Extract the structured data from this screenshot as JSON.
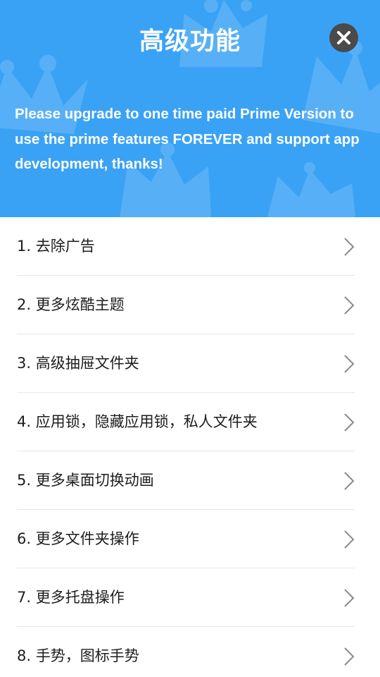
{
  "colors": {
    "header_bg": "#3aa2f5",
    "crown_shape": "#62b6f7",
    "close_button_bg": "#4a4a4a",
    "text_primary": "#1d1d1d",
    "divider": "#e6e6e6",
    "chevron": "#8a8a8a"
  },
  "header": {
    "title": "高级功能",
    "close_icon": "close-icon",
    "background_icon": "crown-icon",
    "message": "Please upgrade to one time paid Prime Version to use the prime features FOREVER and support app development, thanks!"
  },
  "features": [
    {
      "label": "1. 去除广告",
      "icon": "chevron-right-icon"
    },
    {
      "label": "2. 更多炫酷主题",
      "icon": "chevron-right-icon"
    },
    {
      "label": "3. 高级抽屉文件夹",
      "icon": "chevron-right-icon"
    },
    {
      "label": "4. 应用锁，隐藏应用锁，私人文件夹",
      "icon": "chevron-right-icon"
    },
    {
      "label": "5. 更多桌面切换动画",
      "icon": "chevron-right-icon"
    },
    {
      "label": "6. 更多文件夹操作",
      "icon": "chevron-right-icon"
    },
    {
      "label": "7. 更多托盘操作",
      "icon": "chevron-right-icon"
    },
    {
      "label": "8. 手势，图标手势",
      "icon": "chevron-right-icon"
    }
  ]
}
